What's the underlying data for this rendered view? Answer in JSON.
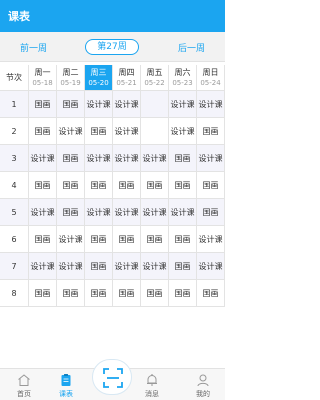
{
  "header": {
    "title": "课表"
  },
  "week_nav": {
    "prev": "前一周",
    "current": "第27周",
    "next": "后一周"
  },
  "table": {
    "corner": "节次",
    "days": [
      {
        "day": "周一",
        "date": "05-18",
        "active": false
      },
      {
        "day": "周二",
        "date": "05-19",
        "active": false
      },
      {
        "day": "周三",
        "date": "05-20",
        "active": true
      },
      {
        "day": "周四",
        "date": "05-21",
        "active": false
      },
      {
        "day": "周五",
        "date": "05-22",
        "active": false
      },
      {
        "day": "周六",
        "date": "05-23",
        "active": false
      },
      {
        "day": "周日",
        "date": "05-24",
        "active": false
      }
    ],
    "rows": [
      {
        "no": "1",
        "cells": [
          "国画",
          "国画",
          "设计课",
          "设计课",
          "",
          "设计课",
          "设计课"
        ],
        "shade": "#f4f4fb"
      },
      {
        "no": "2",
        "cells": [
          "国画",
          "设计课",
          "国画",
          "设计课",
          "",
          "设计课",
          "国画"
        ],
        "shade": "#ffffff"
      },
      {
        "no": "3",
        "cells": [
          "设计课",
          "国画",
          "设计课",
          "设计课",
          "设计课",
          "国画",
          "设计课"
        ],
        "shade": "#f4f4fb"
      },
      {
        "no": "4",
        "cells": [
          "国画",
          "国画",
          "国画",
          "国画",
          "国画",
          "国画",
          "国画"
        ],
        "shade": "#ffffff"
      },
      {
        "no": "5",
        "cells": [
          "设计课",
          "国画",
          "设计课",
          "设计课",
          "设计课",
          "设计课",
          "国画"
        ],
        "shade": "#f4f4fb"
      },
      {
        "no": "6",
        "cells": [
          "国画",
          "设计课",
          "国画",
          "国画",
          "国画",
          "国画",
          "设计课"
        ],
        "shade": "#ffffff"
      },
      {
        "no": "7",
        "cells": [
          "设计课",
          "设计课",
          "国画",
          "设计课",
          "设计课",
          "国画",
          "设计课"
        ],
        "shade": "#f4f4fb"
      },
      {
        "no": "8",
        "cells": [
          "国画",
          "国画",
          "国画",
          "国画",
          "国画",
          "国画",
          "国画"
        ],
        "shade": "#ffffff"
      }
    ]
  },
  "tabbar": {
    "items": [
      {
        "label": "首页",
        "icon": "home-icon",
        "active": false
      },
      {
        "label": "课表",
        "icon": "schedule-icon",
        "active": true
      },
      {
        "label": "",
        "icon": "scan-icon",
        "active": false
      },
      {
        "label": "消息",
        "icon": "message-icon",
        "active": false
      },
      {
        "label": "我的",
        "icon": "profile-icon",
        "active": false
      }
    ]
  },
  "colors": {
    "accent": "#1ba5f0",
    "border": "#e3e3e3",
    "rowShade": "#f4f4fb"
  }
}
